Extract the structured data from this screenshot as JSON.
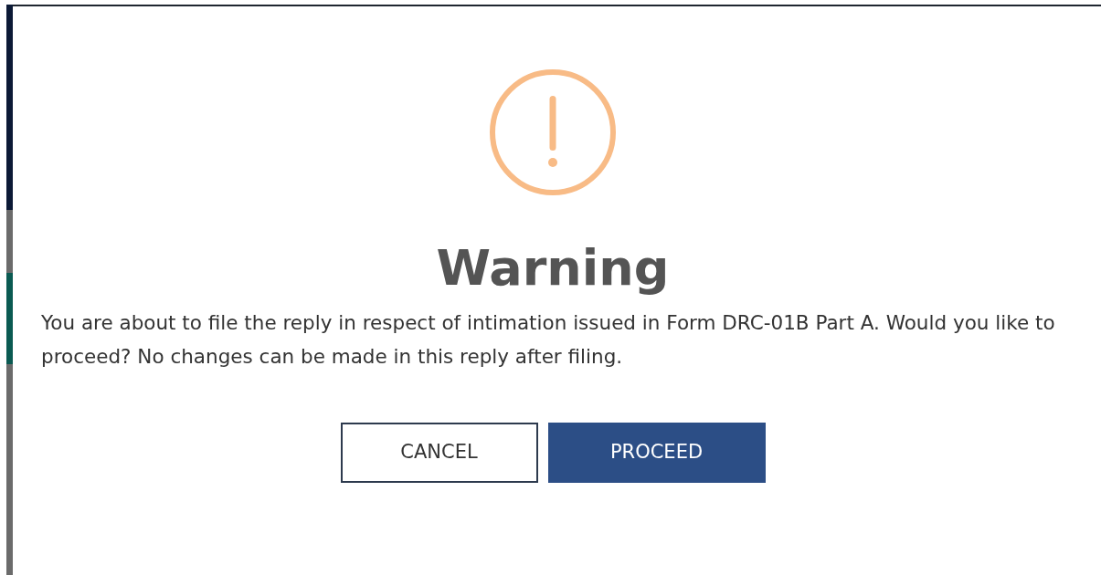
{
  "dialog": {
    "title": "Warning",
    "message": "You are about to file the reply in respect of intimation issued in Form DRC-01B Part A. Would you like to proceed? No changes can be made in this reply after filing.",
    "buttons": [
      {
        "label": "CANCEL",
        "kind": "secondary"
      },
      {
        "label": "PROCEED",
        "kind": "primary"
      }
    ]
  }
}
